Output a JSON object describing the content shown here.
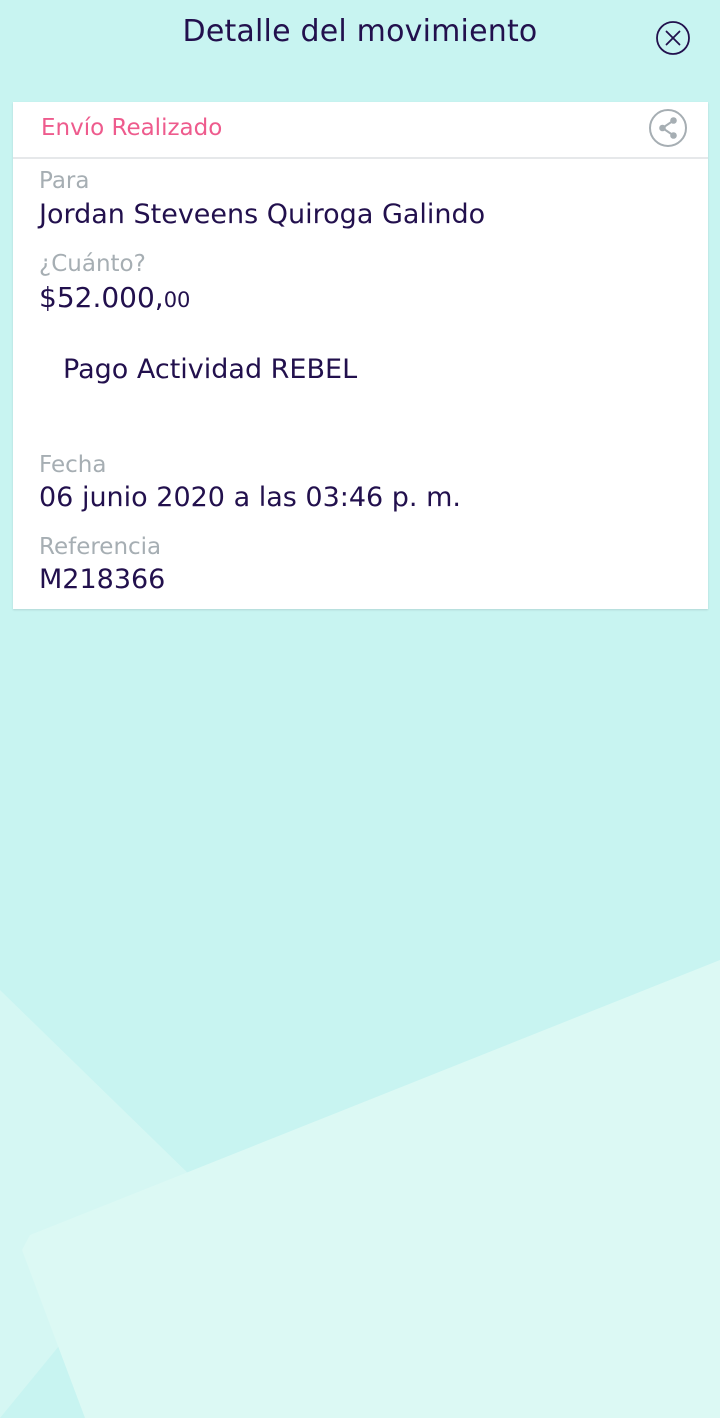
{
  "header": {
    "title": "Detalle del movimiento",
    "close_icon": "close-circle-icon"
  },
  "card": {
    "status": "Envío Realizado",
    "share_icon": "share-icon",
    "recipient": {
      "label": "Para",
      "value": "Jordan Steveens Quiroga Galindo"
    },
    "amount": {
      "label": "¿Cuánto?",
      "main": "$52.000,",
      "cents": "00"
    },
    "description": "Pago Actividad REBEL",
    "date": {
      "label": "Fecha",
      "value": "06 junio 2020 a las 03:46 p. m."
    },
    "reference": {
      "label": "Referencia",
      "value": "M218366"
    }
  },
  "colors": {
    "background": "#c8f4f1",
    "text_primary": "#22104d",
    "status_accent": "#ee5b8d",
    "label_gray": "#a6aeb3",
    "card": "#ffffff"
  }
}
